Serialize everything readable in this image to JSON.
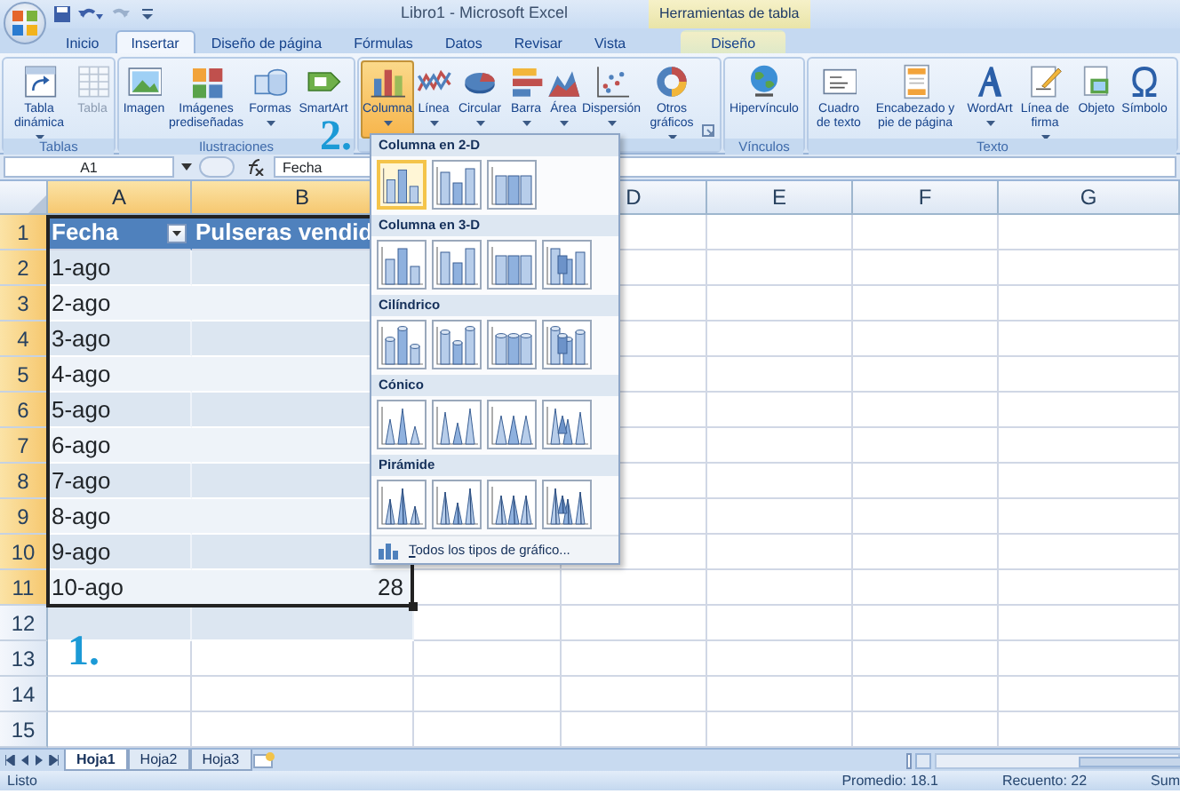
{
  "title_bar": {
    "title": "Libro1 - Microsoft Excel",
    "context_header": "Herramientas de tabla"
  },
  "ribbon_tabs": [
    {
      "label": "Inicio",
      "selected": false,
      "kind": "normal"
    },
    {
      "label": "Insertar",
      "selected": true,
      "kind": "normal"
    },
    {
      "label": "Diseño de página",
      "selected": false,
      "kind": "normal"
    },
    {
      "label": "Fórmulas",
      "selected": false,
      "kind": "normal"
    },
    {
      "label": "Datos",
      "selected": false,
      "kind": "normal"
    },
    {
      "label": "Revisar",
      "selected": false,
      "kind": "normal"
    },
    {
      "label": "Vista",
      "selected": false,
      "kind": "normal"
    },
    {
      "label": "Diseño",
      "selected": false,
      "kind": "contextual"
    }
  ],
  "ribbon_groups": [
    {
      "label": "Tablas",
      "buttons": [
        {
          "label": "Tabla dinámica",
          "dropdown": true,
          "disabled": false,
          "pressed": false
        },
        {
          "label": "Tabla",
          "dropdown": false,
          "disabled": true,
          "pressed": false
        }
      ]
    },
    {
      "label": "Ilustraciones",
      "buttons": [
        {
          "label": "Imagen",
          "dropdown": false,
          "disabled": false,
          "pressed": false
        },
        {
          "label": "Imágenes prediseñadas",
          "dropdown": false,
          "disabled": false,
          "pressed": false
        },
        {
          "label": "Formas",
          "dropdown": true,
          "disabled": false,
          "pressed": false
        },
        {
          "label": "SmartArt",
          "dropdown": false,
          "disabled": false,
          "pressed": false
        }
      ]
    },
    {
      "buttons": [
        {
          "label": "Columna",
          "dropdown": true,
          "disabled": false,
          "pressed": true
        },
        {
          "label": "Línea",
          "dropdown": true,
          "disabled": false,
          "pressed": false
        },
        {
          "label": "Circular",
          "dropdown": true,
          "disabled": false,
          "pressed": false
        },
        {
          "label": "Barra",
          "dropdown": true,
          "disabled": false,
          "pressed": false
        },
        {
          "label": "Área",
          "dropdown": true,
          "disabled": false,
          "pressed": false
        },
        {
          "label": "Dispersión",
          "dropdown": true,
          "disabled": false,
          "pressed": false
        },
        {
          "label": "Otros gráficos",
          "dropdown": true,
          "disabled": false,
          "pressed": false
        }
      ],
      "launcher": true
    },
    {
      "label": "Vínculos",
      "buttons": [
        {
          "label": "Hipervínculo",
          "dropdown": false,
          "disabled": false,
          "pressed": false
        }
      ]
    },
    {
      "label": "Texto",
      "buttons": [
        {
          "label": "Cuadro de texto",
          "dropdown": false,
          "disabled": false,
          "pressed": false
        },
        {
          "label": "Encabezado y pie de página",
          "dropdown": false,
          "disabled": false,
          "pressed": false
        },
        {
          "label": "WordArt",
          "dropdown": true,
          "disabled": false,
          "pressed": false
        },
        {
          "label": "Línea de firma",
          "dropdown": true,
          "disabled": false,
          "pressed": false
        },
        {
          "label": "Objeto",
          "dropdown": false,
          "disabled": false,
          "pressed": false
        },
        {
          "label": "Símbolo",
          "dropdown": false,
          "disabled": false,
          "pressed": false
        }
      ]
    }
  ],
  "formula_bar": {
    "name_box": "A1",
    "formula": "Fecha"
  },
  "columns": [
    {
      "label": "A",
      "selected": true
    },
    {
      "label": "B",
      "selected": true
    },
    {},
    {
      "label": "D",
      "selected": false
    },
    {
      "label": "E",
      "selected": false
    },
    {
      "label": "F",
      "selected": false
    },
    {
      "label": "G",
      "selected": false
    }
  ],
  "rows": [
    {
      "number": "1",
      "selected": true,
      "kind": "header",
      "cells": [
        "Fecha",
        "Pulseras vendid"
      ]
    },
    {
      "number": "2",
      "selected": true,
      "kind": "data",
      "cells": [
        "1-ago"
      ]
    },
    {
      "number": "3",
      "selected": true,
      "kind": "data",
      "cells": [
        "2-ago"
      ]
    },
    {
      "number": "4",
      "selected": true,
      "kind": "data",
      "cells": [
        "3-ago"
      ]
    },
    {
      "number": "5",
      "selected": true,
      "kind": "data",
      "cells": [
        "4-ago"
      ]
    },
    {
      "number": "6",
      "selected": true,
      "kind": "data",
      "cells": [
        "5-ago"
      ]
    },
    {
      "number": "7",
      "selected": true,
      "kind": "data",
      "cells": [
        "6-ago"
      ]
    },
    {
      "number": "8",
      "selected": true,
      "kind": "data",
      "cells": [
        "7-ago"
      ]
    },
    {
      "number": "9",
      "selected": true,
      "kind": "data",
      "cells": [
        "8-ago"
      ]
    },
    {
      "number": "10",
      "selected": true,
      "kind": "data",
      "cells": [
        "9-ago"
      ]
    },
    {
      "number": "11",
      "selected": true,
      "kind": "data",
      "cells": [
        "10-ago",
        "28"
      ]
    },
    {
      "number": "12",
      "selected": false,
      "kind": "data"
    },
    {
      "number": "13",
      "selected": false,
      "kind": "blank"
    },
    {
      "number": "14",
      "selected": false,
      "kind": "blank"
    },
    {
      "number": "15",
      "selected": false,
      "kind": "blank"
    }
  ],
  "chart_menu": {
    "sections": [
      {
        "title": "Columna en 2-D",
        "kind": "column",
        "items": [
          {
            "selected": true
          },
          {
            "selected": false
          },
          {
            "selected": false
          }
        ]
      },
      {
        "title": "Columna en 3-D",
        "kind": "column",
        "items": [
          {
            "selected": false
          },
          {
            "selected": false
          },
          {
            "selected": false
          },
          {
            "selected": false
          }
        ]
      },
      {
        "title": "Cilíndrico",
        "kind": "cylinder",
        "items": [
          {
            "selected": false
          },
          {
            "selected": false
          },
          {
            "selected": false
          },
          {
            "selected": false
          }
        ]
      },
      {
        "title": "Cónico",
        "kind": "cone",
        "items": [
          {
            "selected": false
          },
          {
            "selected": false
          },
          {
            "selected": false
          },
          {
            "selected": false
          }
        ]
      },
      {
        "title": "Pirámide",
        "kind": "pyramid",
        "items": [
          {
            "selected": false
          },
          {
            "selected": false
          },
          {
            "selected": false
          },
          {
            "selected": false
          }
        ]
      }
    ],
    "footer": "Todos los tipos de gráfico..."
  },
  "annotations": [
    "1.",
    "2."
  ],
  "sheet_tabs": [
    {
      "label": "Hoja1",
      "selected": true
    },
    {
      "label": "Hoja2",
      "selected": false
    },
    {
      "label": "Hoja3",
      "selected": false
    }
  ],
  "status_bar": {
    "mode": "Listo",
    "items": [
      "Promedio: 18.1",
      "Recuento: 22",
      "Sum"
    ]
  }
}
